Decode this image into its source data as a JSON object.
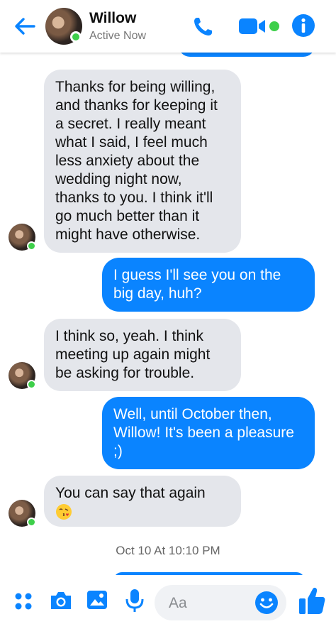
{
  "header": {
    "contact_name": "Willow",
    "contact_status": "Active Now"
  },
  "messages": [
    {
      "from": "them",
      "text": "Thanks for being willing, and thanks for keeping it a secret. I really meant what I said, I feel much less anxiety about the wedding night now, thanks to you. I think it'll go much better than it might have otherwise."
    },
    {
      "from": "me",
      "text": "I guess I'll see you on the big day, huh?"
    },
    {
      "from": "them",
      "text": "I think so, yeah. I think meeting up again might be asking for trouble."
    },
    {
      "from": "me",
      "text": "Well, until October then, Willow! It's been a pleasure ;)"
    },
    {
      "from": "them",
      "text": "You can say that again",
      "emoji": "face-blowing-kiss"
    }
  ],
  "timestamp": "Oct 10 At 10:10 PM",
  "composer": {
    "placeholder": "Aa"
  },
  "colors": {
    "accent": "#0a84ff",
    "incoming_bubble": "#e4e6eb",
    "online": "#3ecf4a"
  }
}
